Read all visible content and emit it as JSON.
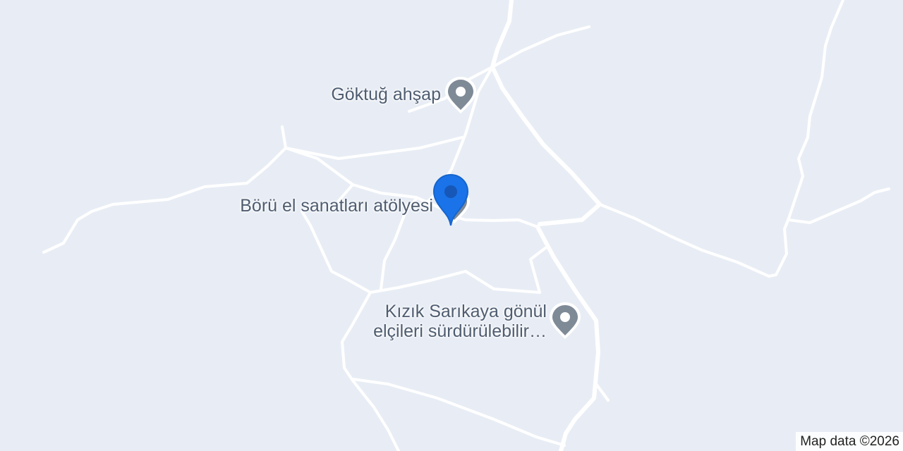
{
  "map": {
    "background_color": "#e8edf5",
    "road_color": "#ffffff",
    "poi_color": "#7f8a97",
    "selected_pin_color": "#1a73e8"
  },
  "places": [
    {
      "name": "Göktuğ ahşap",
      "icon": "place-pin-icon"
    },
    {
      "name": "Börü el sanatları atölyesi",
      "icon": "place-pin-icon",
      "selected": true
    },
    {
      "name_line1": "Kızık Sarıkaya gönül",
      "name_line2": "elçileri sürdürülebilir…",
      "icon": "place-pin-icon"
    }
  ],
  "attribution": "Map data ©2026"
}
